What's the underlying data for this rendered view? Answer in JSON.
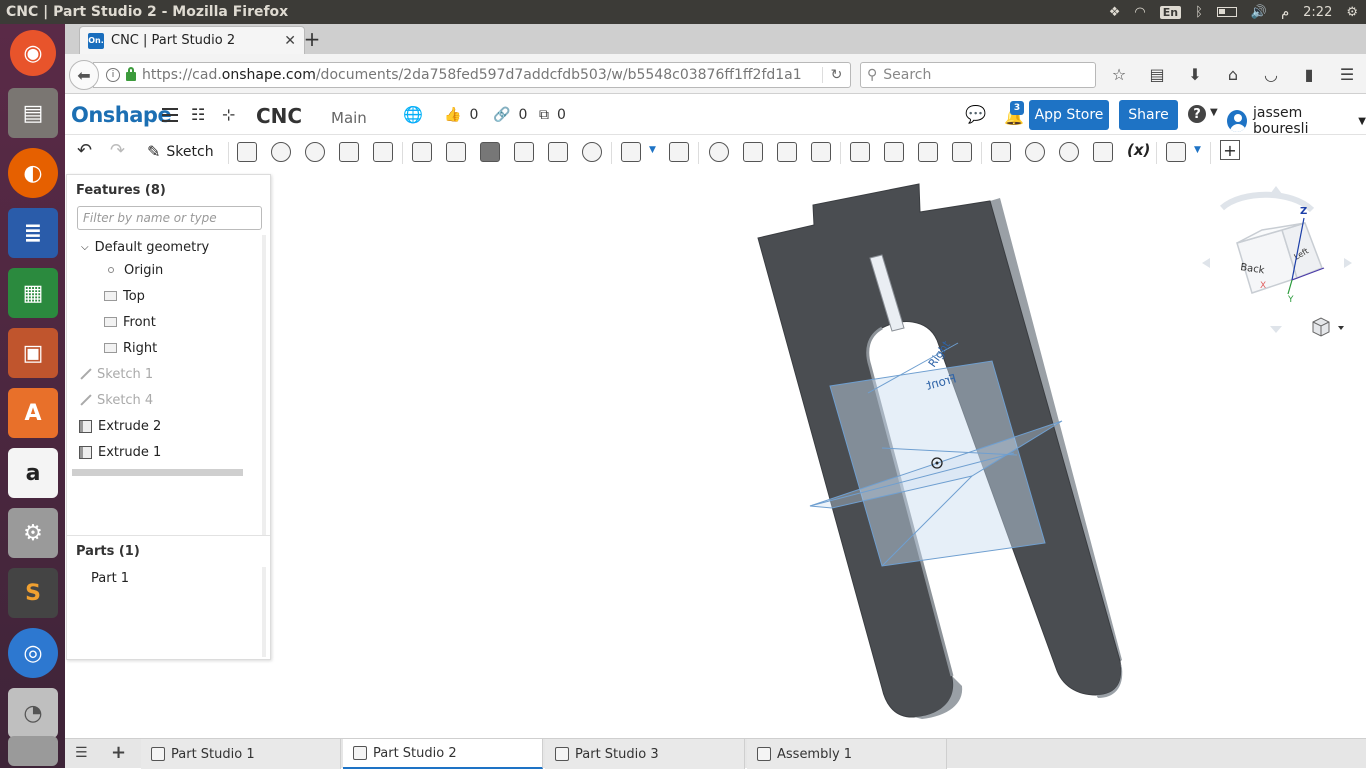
{
  "os_panel": {
    "window_title": "CNC | Part Studio 2 - Mozilla Firefox",
    "keyboard_layout": "En",
    "clock": "2:22",
    "am_pm": "م"
  },
  "browser": {
    "tab_title": "CNC | Part Studio 2",
    "tab_favicon": "On.",
    "url_prefix": "https://cad.",
    "url_domain": "onshape.com",
    "url_path": "/documents/2da758fed597d7addcfdb503/w/b5548c03876ff1ff2fd1a1",
    "search_placeholder": "Search"
  },
  "onshape": {
    "logo": "Onshape",
    "document_name": "CNC",
    "branch": "Main",
    "likes": "0",
    "links": "0",
    "copies": "0",
    "notifications": "3",
    "app_store_label": "App Store",
    "share_label": "Share",
    "user_name": "jassem bouresli"
  },
  "toolbar": {
    "sketch_label": "Sketch",
    "variable_label": "(x)"
  },
  "features": {
    "header": "Features (8)",
    "filter_placeholder": "Filter by name or type",
    "default_geometry": "Default geometry",
    "items": {
      "origin": "Origin",
      "top": "Top",
      "front": "Front",
      "right": "Right",
      "sketch1": "Sketch 1",
      "sketch4": "Sketch 4",
      "extrude2": "Extrude 2",
      "extrude1": "Extrude 1"
    }
  },
  "parts": {
    "header": "Parts (1)",
    "part1": "Part 1"
  },
  "viewport": {
    "plane_front": "Front",
    "plane_right": "Right",
    "cube_back": "Back",
    "cube_left": "Left",
    "axis_z": "Z",
    "axis_x": "X",
    "axis_y": "Y",
    "part_color": "#4a4d51"
  },
  "tabs": {
    "t1": "Part Studio 1",
    "t2": "Part Studio 2",
    "t3": "Part Studio 3",
    "t4": "Assembly 1"
  }
}
